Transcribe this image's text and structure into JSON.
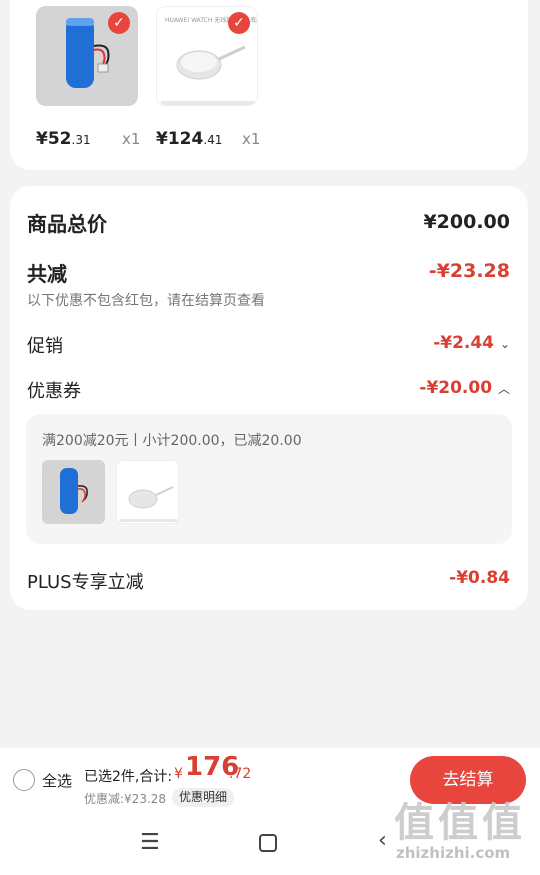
{
  "products": [
    {
      "name": "battery",
      "price_int": "¥52",
      "price_dec": ".31",
      "qty": "x1"
    },
    {
      "name": "charger",
      "price_int": "¥124",
      "price_dec": ".41",
      "qty": "x1",
      "image_text": "HUAWEI WATCH 无线超级快充底座"
    }
  ],
  "summary": {
    "total_label": "商品总价",
    "total_value": "¥200.00",
    "discount_label": "共减",
    "discount_value": "-¥23.28",
    "note": "以下优惠不包含红包，请在结算页查看",
    "promo_label": "促销",
    "promo_value": "-¥2.44",
    "coupon_label": "优惠券",
    "coupon_value": "-¥20.00",
    "coupon_detail": "满200减20元丨小计200.00，已减20.00",
    "plus_label": "PLUS专享立减",
    "plus_value": "-¥0.84"
  },
  "bottom": {
    "select_all": "全选",
    "selected_text": "已选2件,合计:",
    "total_symbol": "¥",
    "total_int": "176",
    "total_dec": ".72",
    "discount_line": "优惠减:¥23.28",
    "discount_detail_btn": "优惠明细",
    "checkout_label": "去结算"
  },
  "watermark": {
    "big": "值值值",
    "small": "zhizhizhi.com"
  },
  "colors": {
    "accent": "#e8453c",
    "discount": "#d94033",
    "background": "#f3f3f3"
  },
  "icons": [
    "check-icon",
    "chevron-down-icon",
    "chevron-up-icon",
    "menu-icon",
    "home-icon",
    "back-icon"
  ]
}
